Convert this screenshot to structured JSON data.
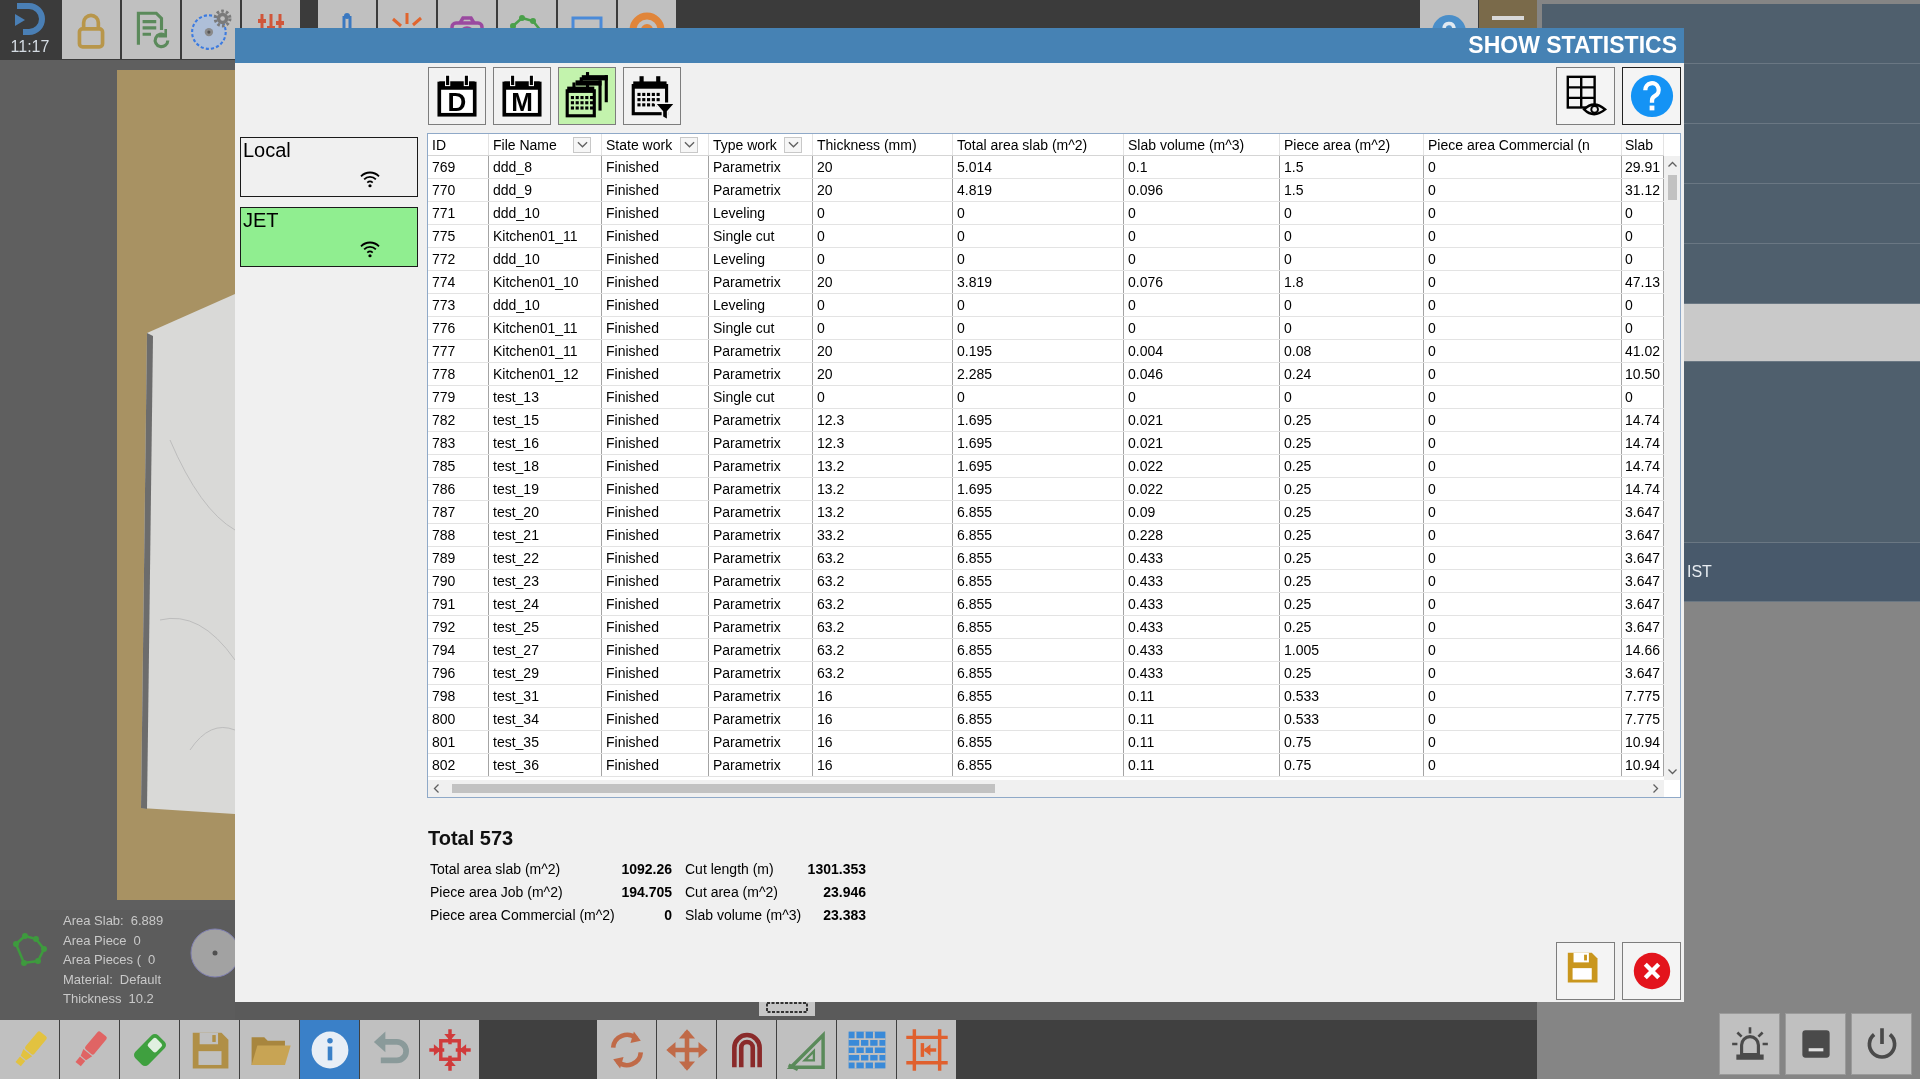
{
  "background": {
    "clock": "11:17",
    "machine_info": [
      {
        "label": "Area Slab:",
        "value": "6.889"
      },
      {
        "label": "Area Piece",
        "value": "0"
      },
      {
        "label": "Area Pieces (",
        "value": "0"
      },
      {
        "label": "Material:",
        "value": "Default"
      },
      {
        "label": "Thickness",
        "value": "10.2"
      }
    ],
    "tools_left": [
      {
        "selected": false
      },
      {
        "selected": false
      },
      {
        "selected": false
      },
      {
        "selected": false
      },
      {
        "selected": false
      },
      {
        "selected": true
      },
      {
        "selected": false
      },
      {
        "selected": false
      }
    ],
    "tools_center": [
      {
        "selected": false
      },
      {
        "selected": false
      },
      {
        "selected": false
      },
      {
        "selected": false
      },
      {
        "selected": false
      },
      {
        "selected": false
      }
    ],
    "side_panel": {
      "label": "IST"
    }
  },
  "dialog": {
    "title": "SHOW STATISTICS",
    "connections": [
      {
        "name": "Local",
        "selected": false
      },
      {
        "name": "JET",
        "selected": true
      }
    ],
    "period_buttons": [
      {
        "kind": "letter",
        "label": "D",
        "selected": false
      },
      {
        "kind": "letter",
        "label": "M",
        "selected": false
      },
      {
        "kind": "range",
        "selected": true
      },
      {
        "kind": "filter",
        "selected": false
      }
    ],
    "table": {
      "columns": [
        {
          "label": "ID",
          "filter": false
        },
        {
          "label": "File Name",
          "filter": true
        },
        {
          "label": "State work",
          "filter": true
        },
        {
          "label": "Type work",
          "filter": true
        },
        {
          "label": "Thickness (mm)",
          "filter": false
        },
        {
          "label": "Total area slab (m^2)",
          "filter": false
        },
        {
          "label": "Slab volume (m^3)",
          "filter": false
        },
        {
          "label": "Piece area (m^2)",
          "filter": false
        },
        {
          "label": "Piece area Commercial (n",
          "filter": false
        },
        {
          "label": "Slab",
          "filter": false
        }
      ],
      "rows": [
        [
          "769",
          "ddd_8",
          "Finished",
          "Parametrix",
          "20",
          "5.014",
          "0.1",
          "1.5",
          "0",
          "29.91"
        ],
        [
          "770",
          "ddd_9",
          "Finished",
          "Parametrix",
          "20",
          "4.819",
          "0.096",
          "1.5",
          "0",
          "31.12"
        ],
        [
          "771",
          "ddd_10",
          "Finished",
          "Leveling",
          "0",
          "0",
          "0",
          "0",
          "0",
          "0"
        ],
        [
          "775",
          "Kitchen01_11",
          "Finished",
          "Single cut",
          "0",
          "0",
          "0",
          "0",
          "0",
          "0"
        ],
        [
          "772",
          "ddd_10",
          "Finished",
          "Leveling",
          "0",
          "0",
          "0",
          "0",
          "0",
          "0"
        ],
        [
          "774",
          "Kitchen01_10",
          "Finished",
          "Parametrix",
          "20",
          "3.819",
          "0.076",
          "1.8",
          "0",
          "47.13"
        ],
        [
          "773",
          "ddd_10",
          "Finished",
          "Leveling",
          "0",
          "0",
          "0",
          "0",
          "0",
          "0"
        ],
        [
          "776",
          "Kitchen01_11",
          "Finished",
          "Single cut",
          "0",
          "0",
          "0",
          "0",
          "0",
          "0"
        ],
        [
          "777",
          "Kitchen01_11",
          "Finished",
          "Parametrix",
          "20",
          "0.195",
          "0.004",
          "0.08",
          "0",
          "41.02"
        ],
        [
          "778",
          "Kitchen01_12",
          "Finished",
          "Parametrix",
          "20",
          "2.285",
          "0.046",
          "0.24",
          "0",
          "10.50"
        ],
        [
          "779",
          "test_13",
          "Finished",
          "Single cut",
          "0",
          "0",
          "0",
          "0",
          "0",
          "0"
        ],
        [
          "782",
          "test_15",
          "Finished",
          "Parametrix",
          "12.3",
          "1.695",
          "0.021",
          "0.25",
          "0",
          "14.74"
        ],
        [
          "783",
          "test_16",
          "Finished",
          "Parametrix",
          "12.3",
          "1.695",
          "0.021",
          "0.25",
          "0",
          "14.74"
        ],
        [
          "785",
          "test_18",
          "Finished",
          "Parametrix",
          "13.2",
          "1.695",
          "0.022",
          "0.25",
          "0",
          "14.74"
        ],
        [
          "786",
          "test_19",
          "Finished",
          "Parametrix",
          "13.2",
          "1.695",
          "0.022",
          "0.25",
          "0",
          "14.74"
        ],
        [
          "787",
          "test_20",
          "Finished",
          "Parametrix",
          "13.2",
          "6.855",
          "0.09",
          "0.25",
          "0",
          "3.647"
        ],
        [
          "788",
          "test_21",
          "Finished",
          "Parametrix",
          "33.2",
          "6.855",
          "0.228",
          "0.25",
          "0",
          "3.647"
        ],
        [
          "789",
          "test_22",
          "Finished",
          "Parametrix",
          "63.2",
          "6.855",
          "0.433",
          "0.25",
          "0",
          "3.647"
        ],
        [
          "790",
          "test_23",
          "Finished",
          "Parametrix",
          "63.2",
          "6.855",
          "0.433",
          "0.25",
          "0",
          "3.647"
        ],
        [
          "791",
          "test_24",
          "Finished",
          "Parametrix",
          "63.2",
          "6.855",
          "0.433",
          "0.25",
          "0",
          "3.647"
        ],
        [
          "792",
          "test_25",
          "Finished",
          "Parametrix",
          "63.2",
          "6.855",
          "0.433",
          "0.25",
          "0",
          "3.647"
        ],
        [
          "794",
          "test_27",
          "Finished",
          "Parametrix",
          "63.2",
          "6.855",
          "0.433",
          "1.005",
          "0",
          "14.66"
        ],
        [
          "796",
          "test_29",
          "Finished",
          "Parametrix",
          "63.2",
          "6.855",
          "0.433",
          "0.25",
          "0",
          "3.647"
        ],
        [
          "798",
          "test_31",
          "Finished",
          "Parametrix",
          "16",
          "6.855",
          "0.11",
          "0.533",
          "0",
          "7.775"
        ],
        [
          "800",
          "test_34",
          "Finished",
          "Parametrix",
          "16",
          "6.855",
          "0.11",
          "0.533",
          "0",
          "7.775"
        ],
        [
          "801",
          "test_35",
          "Finished",
          "Parametrix",
          "16",
          "6.855",
          "0.11",
          "0.75",
          "0",
          "10.94"
        ],
        [
          "802",
          "test_36",
          "Finished",
          "Parametrix",
          "16",
          "6.855",
          "0.11",
          "0.75",
          "0",
          "10.94"
        ]
      ]
    },
    "summary": {
      "title": "Total 573",
      "stats": [
        {
          "label": "Total area slab (m^2)",
          "value": "1092.26"
        },
        {
          "label": "Cut length (m)",
          "value": "1301.353"
        },
        {
          "label": "Piece area Job (m^2)",
          "value": "194.705"
        },
        {
          "label": "Cut area (m^2)",
          "value": "23.946"
        },
        {
          "label": "Piece area Commercial (m^2)",
          "value": "0"
        },
        {
          "label": "Slab volume (m^3)",
          "value": "23.383"
        }
      ]
    }
  }
}
